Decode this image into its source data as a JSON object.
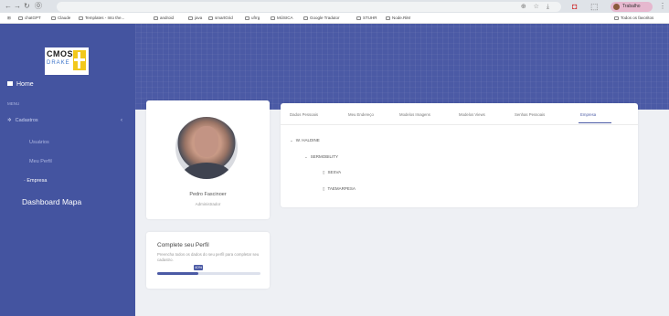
{
  "browser": {
    "back_icon": "arrow-left-icon",
    "forward_icon": "arrow-right-icon",
    "reload_icon": "reload-icon",
    "profile_label": "Trabalho",
    "bookmarks": [
      {
        "label": "chatGPT"
      },
      {
        "label": "Claude"
      },
      {
        "label": "Templates - Into the..."
      },
      {
        "label": "android"
      },
      {
        "label": "java"
      },
      {
        "label": "smartGrid"
      },
      {
        "label": "ufrrg"
      },
      {
        "label": "MÚSICA"
      },
      {
        "label": "Google Tradutor"
      },
      {
        "label": "STUHR"
      },
      {
        "label": "Node.RiM"
      }
    ],
    "bookmarks_right": "Todos os favoritos"
  },
  "sidebar": {
    "logo_top": "CMOS",
    "logo_bottom": "DRAKE",
    "home_label": "Home",
    "section_label": "MENU",
    "cadastros_label": "Cadastros",
    "sub_items": [
      "Usuários",
      "Meu Perfil",
      "Empresa"
    ],
    "dashboard_label": "Dashboard Mapa"
  },
  "profile": {
    "name": "Pedro Fascinoer",
    "role": "Administrador"
  },
  "complete": {
    "title": "Complete seu Perfil",
    "text": "Preencha todos os dados do seu perfil para completar seu cadastro.",
    "progress_label": "40%",
    "progress": 0.4
  },
  "tabs": [
    "Dados Pessoais",
    "Meu Endereço",
    "Modelos Imagens",
    "Modelos Views",
    "Senhas Pessoais",
    "Empresa"
  ],
  "active_tab": 5,
  "tree": {
    "root": "W. HALDINE",
    "child": "SERMOBILITY",
    "leaves": [
      "SESVA",
      "TAEMARPESA"
    ]
  },
  "colors": {
    "sidebar": "#4454a0",
    "accent": "#4b5aa5",
    "background": "#eef0f4"
  }
}
